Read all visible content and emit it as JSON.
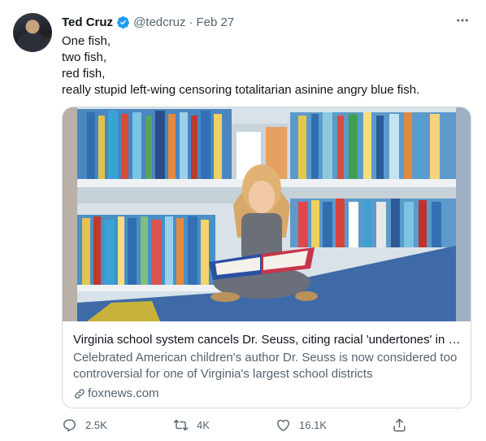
{
  "author": {
    "name": "Ted Cruz",
    "handle": "@tedcruz",
    "separator": "·",
    "date": "Feb 27"
  },
  "tweet": {
    "lines": [
      "One fish,",
      "two fish,",
      "red fish,",
      "really stupid left-wing censoring totalitarian asinine angry blue fish."
    ]
  },
  "card": {
    "title": "Virginia school system cancels Dr. Seuss, citing racial 'undertones' in wr...",
    "description": "Celebrated American children's author Dr. Seuss is now considered too controversial for one of Virginia's largest school districts",
    "domain": "foxnews.com"
  },
  "actions": {
    "replies": "2.5K",
    "retweets": "4K",
    "likes": "16.1K"
  },
  "colors": {
    "verified": "#1d9bf0",
    "secondary_text": "#536471",
    "border": "#cfd9de"
  },
  "icons": [
    "verified-badge-icon",
    "more-icon",
    "link-icon",
    "reply-icon",
    "retweet-icon",
    "like-icon",
    "share-icon"
  ]
}
